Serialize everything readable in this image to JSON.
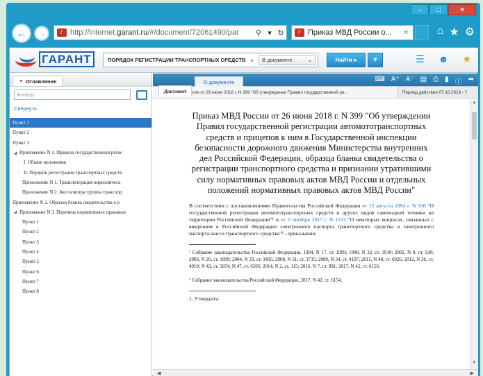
{
  "browser": {
    "address": {
      "url_prefix": "http://internet.",
      "url_domain": "garant.ru",
      "url_suffix": "/#/document/72061490/par"
    },
    "tab": {
      "title": "Приказ МВД России о..."
    },
    "window_buttons": {
      "minimize": "–",
      "maximize": "□",
      "close": "×"
    }
  },
  "app": {
    "logo_text": "ГАРАНТ",
    "search": {
      "query": "ПОРЯДОК РЕГИСТРАЦИИ ТРАНСПОРТНЫХ СРЕДСТВ",
      "scope": "В документе"
    },
    "find_button": "Найти"
  },
  "left_panel": {
    "tab_label": "Оглавление",
    "filter_placeholder": "Фильтр",
    "collapse_link": "Свернуть",
    "items": [
      {
        "label": "Пункт 1",
        "level": 0,
        "prefix": "",
        "selected": true
      },
      {
        "label": "Пункт 2",
        "level": 0,
        "prefix": "",
        "selected": false
      },
      {
        "label": "Пункт 3",
        "level": 0,
        "prefix": "",
        "selected": false
      },
      {
        "label": "Приложение N 1. Правила государственной регис",
        "level": 0,
        "prefix": "◢",
        "selected": false
      },
      {
        "label": "I. Общие положения",
        "level": 1,
        "prefix": "›",
        "selected": false
      },
      {
        "label": "II. Порядок регистрации транспортных средств",
        "level": 1,
        "prefix": "›",
        "selected": false
      },
      {
        "label": "Приложение N 1. Транслитерация кириллическ",
        "level": 2,
        "prefix": "",
        "selected": false
      },
      {
        "label": "Приложение N 2. Акт осмотра группы транспор",
        "level": 2,
        "prefix": "",
        "selected": false
      },
      {
        "label": "Приложение N 2. Образец бланка свидетельства о р",
        "level": 0,
        "prefix": "",
        "selected": false
      },
      {
        "label": "Приложение N 3. Перечень нормативных правовых",
        "level": 0,
        "prefix": "◢",
        "selected": false
      },
      {
        "label": "Пункт 1",
        "level": 2,
        "prefix": "",
        "selected": false
      },
      {
        "label": "Пункт 2",
        "level": 2,
        "prefix": "",
        "selected": false
      },
      {
        "label": "Пункт 3",
        "level": 2,
        "prefix": "",
        "selected": false
      },
      {
        "label": "Пункт 4",
        "level": 2,
        "prefix": "",
        "selected": false
      },
      {
        "label": "Пункт 5",
        "level": 2,
        "prefix": "",
        "selected": false
      },
      {
        "label": "Пункт 6",
        "level": 2,
        "prefix": "",
        "selected": false
      },
      {
        "label": "Пункт 7",
        "level": 2,
        "prefix": "",
        "selected": false
      },
      {
        "label": "Пункт 8",
        "level": 2,
        "prefix": "",
        "selected": false
      }
    ]
  },
  "right_panel": {
    "tabs": {
      "document": "Документ",
      "about": "О документе"
    },
    "doc_title_line": "Приказ МВД России от 26 июня 2018 г. N 399 \"Об утверждении Правил государственной ре...",
    "validity": "Период действия 07.10.2018 - ?",
    "heading": "Приказ МВД России от 26 июня 2018 г. N 399 \"Об утверждении Правил государственной регистрации автомототранспортных средств и прицепов к ним в Государственной инспекции безопасности дорожного движения Министерства внутренних дел Российской Федерации, образца бланка свидетельства о регистрации транспортного средства и признании утратившими силу нормативных правовых актов МВД России и отдельных положений нормативных правовых актов МВД России\"",
    "para1": {
      "t1": "В соответствии с постановлениями Правительства Российской Федерации ",
      "link1": "от 12 августа 1994 г. N 938",
      "t2": " \"О государственной регистрации автомототранспортных средств и других видов самоходной техники на территории Российской Федерации\"¹ и ",
      "link2": "от 5 октября 2017 г. N 1212",
      "t3": " \"О некоторых вопросах, связанных с введением в Российской Федерации электронного паспорта транспортного средства и электронного паспорта шасси транспортного средства\"² - приказываю:"
    },
    "footnote1": "¹ Собрание законодательства Российской Федерации, 1994, N 17, ст. 1999; 1998, N 32, ст. 3910; 2002, N 9, ст. 930; 2003, N 20, ст. 1899; 2004, N 33, ст. 3495; 2008, N 31, ст. 3735; 2009, N 34, ст. 4197; 2011, N 48, ст. 6926; 2012, N 36, ст. 4919; N 43, ст. 5874; N 47, ст. 6505; 2014, N 2, ст. 115; 2016, N 7, ст. 991; 2017, N 42, ст. 6156.",
    "footnote2": "² Собрание законодательства Российской Федерации, 2017, N 42, ст. 6154.",
    "item1": "1. Утвердить:"
  },
  "colors": {
    "accent": "#2b77c8",
    "window": "#1e9bc8",
    "background": "#d7ecd9"
  }
}
